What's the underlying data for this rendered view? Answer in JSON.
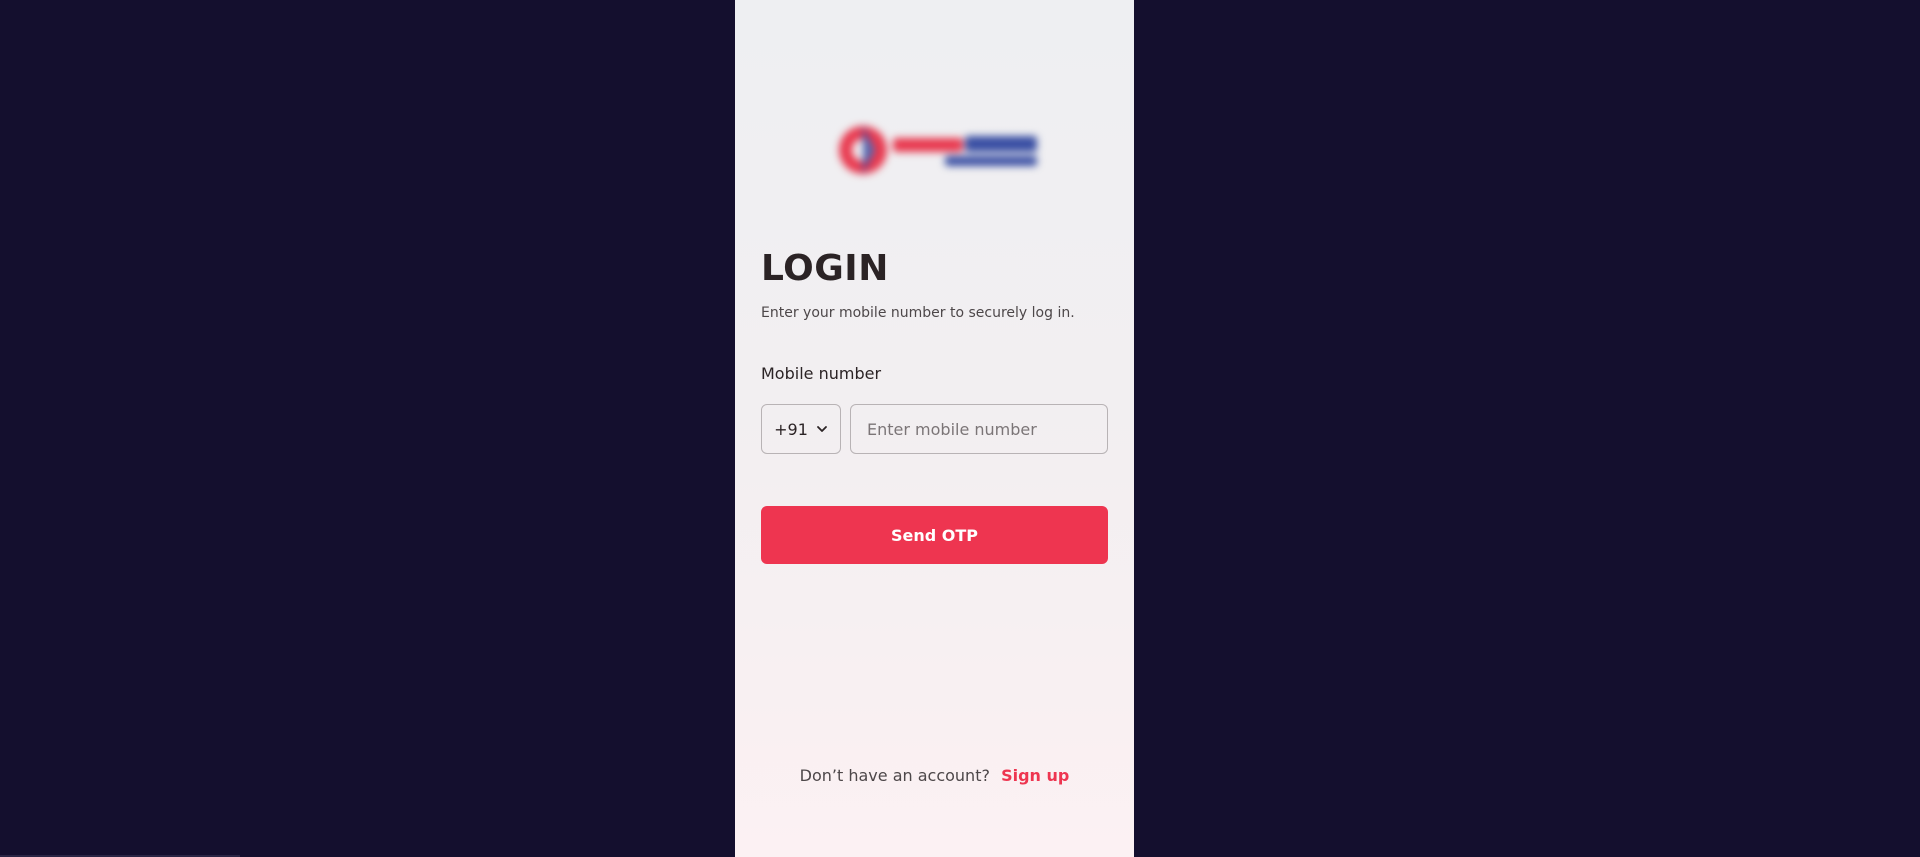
{
  "login": {
    "title": "LOGIN",
    "subtitle": "Enter your mobile number to securely log in.",
    "mobile_label": "Mobile number",
    "country_code": "+91",
    "mobile_placeholder": "Enter mobile number",
    "mobile_value": "",
    "send_button": "Send OTP",
    "signup_prompt": "Don’t have an account?",
    "signup_link": "Sign up"
  },
  "icons": {
    "logo": "brand-logo",
    "country_code_caret": "chevron-down-icon"
  },
  "colors": {
    "page_background": "#140f2e",
    "accent": "#ee3550",
    "logo_red": "#e8394f",
    "logo_blue": "#3a4fa3"
  }
}
